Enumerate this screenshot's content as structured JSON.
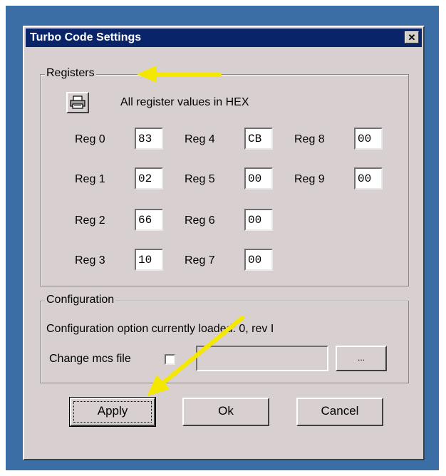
{
  "dialog": {
    "title": "Turbo Code Settings",
    "close_glyph": "✕"
  },
  "registers": {
    "group_label": "Registers",
    "hex_note": "All register values in HEX",
    "print_icon": "printer-icon",
    "reg0": {
      "label": "Reg 0",
      "value": "83"
    },
    "reg1": {
      "label": "Reg 1",
      "value": "02"
    },
    "reg2": {
      "label": "Reg 2",
      "value": "66"
    },
    "reg3": {
      "label": "Reg 3",
      "value": "10"
    },
    "reg4": {
      "label": "Reg 4",
      "value": "CB"
    },
    "reg5": {
      "label": "Reg 5",
      "value": "00"
    },
    "reg6": {
      "label": "Reg 6",
      "value": "00"
    },
    "reg7": {
      "label": "Reg 7",
      "value": "00"
    },
    "reg8": {
      "label": "Reg 8",
      "value": "00"
    },
    "reg9": {
      "label": "Reg 9",
      "value": "00"
    }
  },
  "configuration": {
    "group_label": "Configuration",
    "status_text": "Configuration option currently loaded: 0, rev I",
    "change_label": "Change mcs file",
    "change_checked": false,
    "file_path": "",
    "browse_label": "..."
  },
  "buttons": {
    "apply": "Apply",
    "ok": "Ok",
    "cancel": "Cancel"
  },
  "colors": {
    "desktop": "#3a6ea5",
    "titlebar": "#0a246a",
    "dialog_bg": "#d8d0d0",
    "annotation_arrow": "#f5e800"
  }
}
